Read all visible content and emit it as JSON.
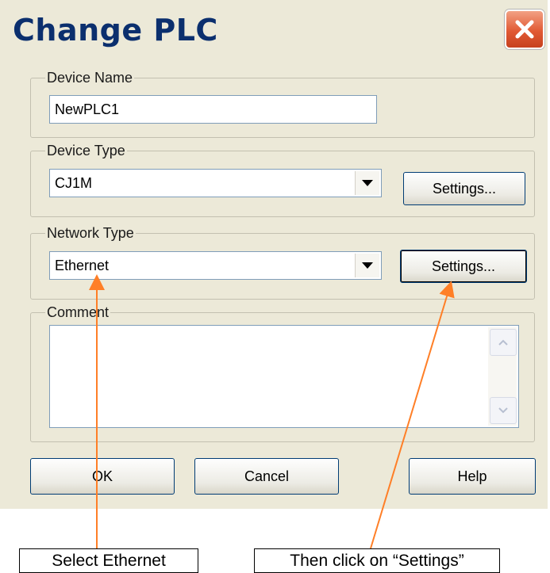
{
  "window": {
    "title": "Change PLC"
  },
  "device_name": {
    "legend": "Device Name",
    "value": "NewPLC1"
  },
  "device_type": {
    "legend": "Device Type",
    "value": "CJ1M",
    "settings_label": "Settings..."
  },
  "network_type": {
    "legend": "Network Type",
    "value": "Ethernet",
    "settings_label": "Settings..."
  },
  "comment": {
    "legend": "Comment",
    "value": ""
  },
  "buttons": {
    "ok": "OK",
    "cancel": "Cancel",
    "help": "Help"
  },
  "annotations": {
    "select_ethernet": "Select Ethernet",
    "click_settings": "Then click on “Settings”"
  },
  "colors": {
    "title_text": "#0b2f6e",
    "close_button": "#e15a34",
    "dialog_bg": "#ece9d8",
    "arrow": "#ff7f27"
  }
}
